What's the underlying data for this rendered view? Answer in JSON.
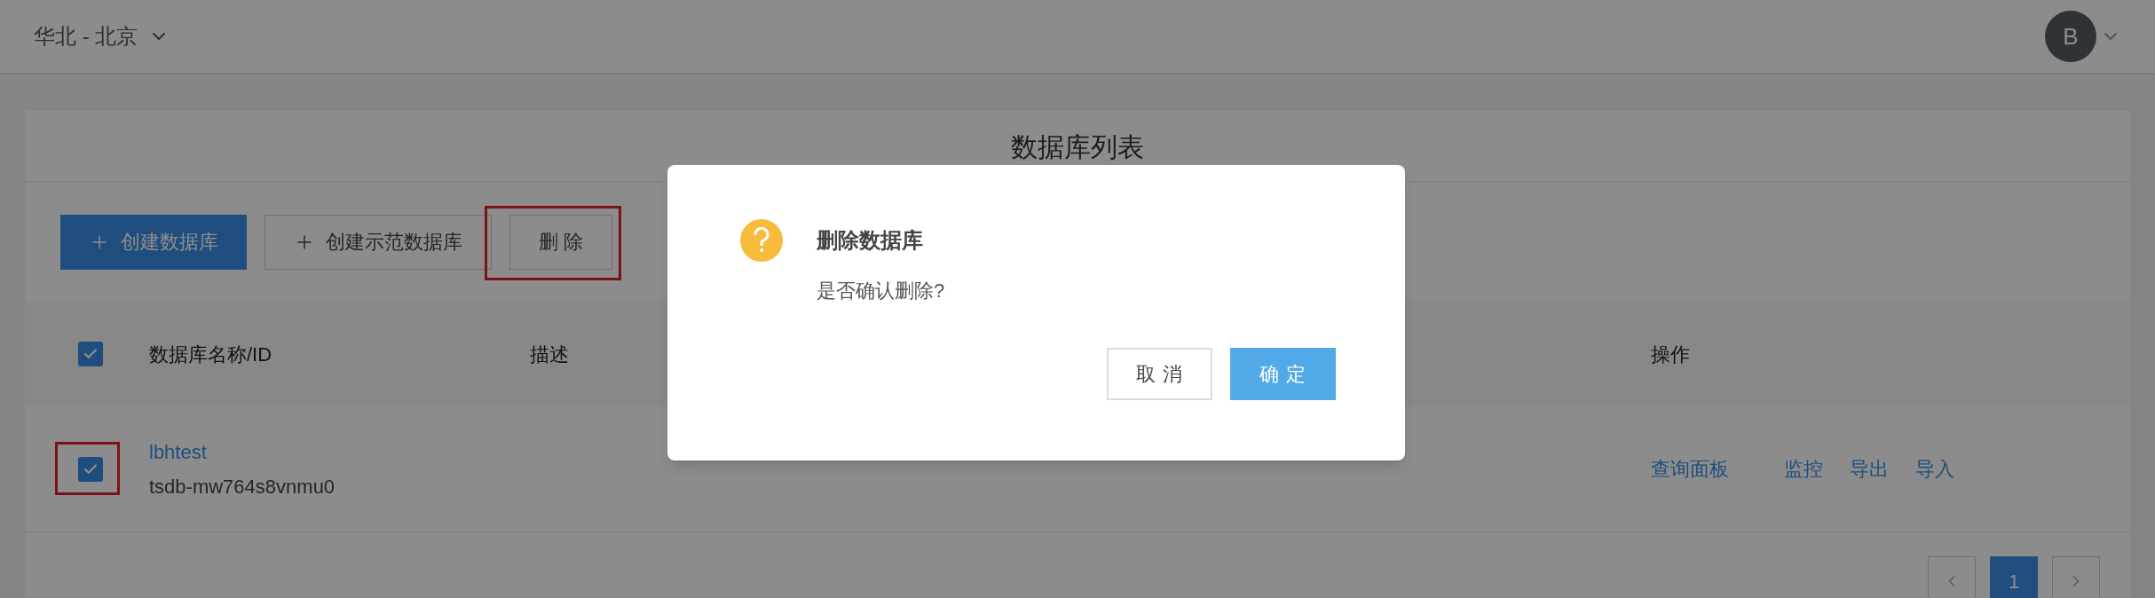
{
  "region_selector": {
    "label": "华北 - 北京"
  },
  "user": {
    "initial": "B"
  },
  "card": {
    "title": "数据库列表"
  },
  "toolbar": [
    {
      "label": "创建数据库",
      "kind": "primary",
      "plus": true,
      "highlighted": false
    },
    {
      "label": "创建示范数据库",
      "kind": "default",
      "plus": true,
      "highlighted": false
    },
    {
      "label": "删 除",
      "kind": "default",
      "plus": false,
      "highlighted": true
    }
  ],
  "table": {
    "select_all": {
      "checked": true
    },
    "columns": [
      "数据库名称/ID",
      "描述",
      "操作"
    ],
    "rows": [
      {
        "checked": true,
        "highlighted": true,
        "name": "lbhtest",
        "id": "tsdb-mw764s8vnmu0",
        "actions": [
          "查询面板",
          "监控",
          "导出",
          "导入"
        ]
      }
    ]
  },
  "pagination": {
    "pages": [
      {
        "label": "1",
        "selected": true
      }
    ]
  },
  "dialog": {
    "title": "删除数据库",
    "message": "是否确认删除?",
    "buttons": [
      {
        "label": "取 消",
        "kind": "default"
      },
      {
        "label": "确 定",
        "kind": "primary"
      }
    ]
  }
}
